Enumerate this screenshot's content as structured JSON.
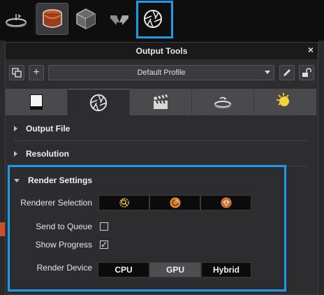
{
  "toolbar": {
    "items": [
      {
        "icon": "turntable-icon"
      },
      {
        "icon": "material-bowl-icon",
        "state": "pressed"
      },
      {
        "icon": "box-icon"
      },
      {
        "icon": "flip-arrows-icon"
      },
      {
        "icon": "aperture-icon",
        "state": "highlighted"
      }
    ]
  },
  "panel": {
    "title": "Output Tools",
    "close_label": "×",
    "profile": {
      "selected": "Default Profile",
      "add_label": "+"
    },
    "tabs": [
      {
        "icon": "image-frame-icon",
        "active": false
      },
      {
        "icon": "aperture-icon",
        "active": true
      },
      {
        "icon": "clapperboard-icon",
        "active": false
      },
      {
        "icon": "turntable-icon",
        "active": false
      },
      {
        "icon": "sun-moon-icon",
        "active": false
      }
    ],
    "sections": {
      "output_file": {
        "label": "Output File",
        "expanded": false
      },
      "resolution": {
        "label": "Resolution",
        "expanded": false
      },
      "render_settings": {
        "label": "Render Settings",
        "expanded": true
      }
    },
    "render_settings": {
      "renderer_selection_label": "Renderer Selection",
      "renderers": [
        {
          "icon": "cpu-renderer-icon",
          "selected": false
        },
        {
          "icon": "gpu-renderer-icon",
          "selected": true
        },
        {
          "icon": "hybrid-renderer-icon",
          "selected": false
        }
      ],
      "send_to_queue_label": "Send to Queue",
      "send_to_queue_checked": false,
      "show_progress_label": "Show Progress",
      "show_progress_checked": true,
      "check_mark": "✓",
      "render_device_label": "Render Device",
      "devices": [
        {
          "label": "CPU",
          "selected": false
        },
        {
          "label": "GPU",
          "selected": true
        },
        {
          "label": "Hybrid",
          "selected": false
        }
      ]
    }
  },
  "colors": {
    "highlight": "#1e9be8",
    "accent_orange": "#d9822b",
    "renderer_yellow": "#e8c020"
  }
}
